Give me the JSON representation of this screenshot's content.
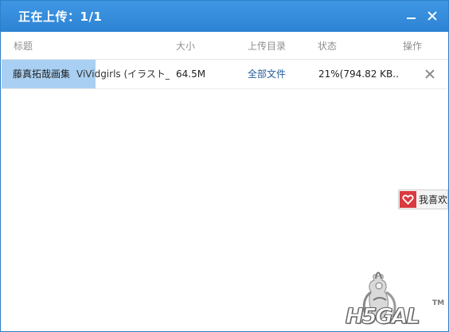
{
  "window": {
    "title": "正在上传：1/1"
  },
  "table": {
    "headers": {
      "title": "标题",
      "size": "大小",
      "dir": "上传目录",
      "status": "状态",
      "operation": "操作"
    },
    "rows": [
      {
        "title_main": "藤真拓哉画集",
        "title_sub": "ViVidgirls (イラスト_...",
        "size": "64.5M",
        "dir": "全部文件",
        "status": "21%(794.82 KB...",
        "progress": 0.21
      }
    ]
  },
  "favorite": {
    "label": "我喜欢"
  },
  "watermark": {
    "text": "H5GAL",
    "trademark": "TM"
  },
  "colors": {
    "titlebar": "#2d83d3",
    "progress": "#a9d0f2",
    "link": "#245c9a",
    "heart": "#d93a3f"
  },
  "icons": {
    "minimize": "minimize-icon",
    "close": "close-icon",
    "row_cancel": "close-icon",
    "favorite": "heart-icon",
    "mascot": "anime-mascot-icon"
  }
}
